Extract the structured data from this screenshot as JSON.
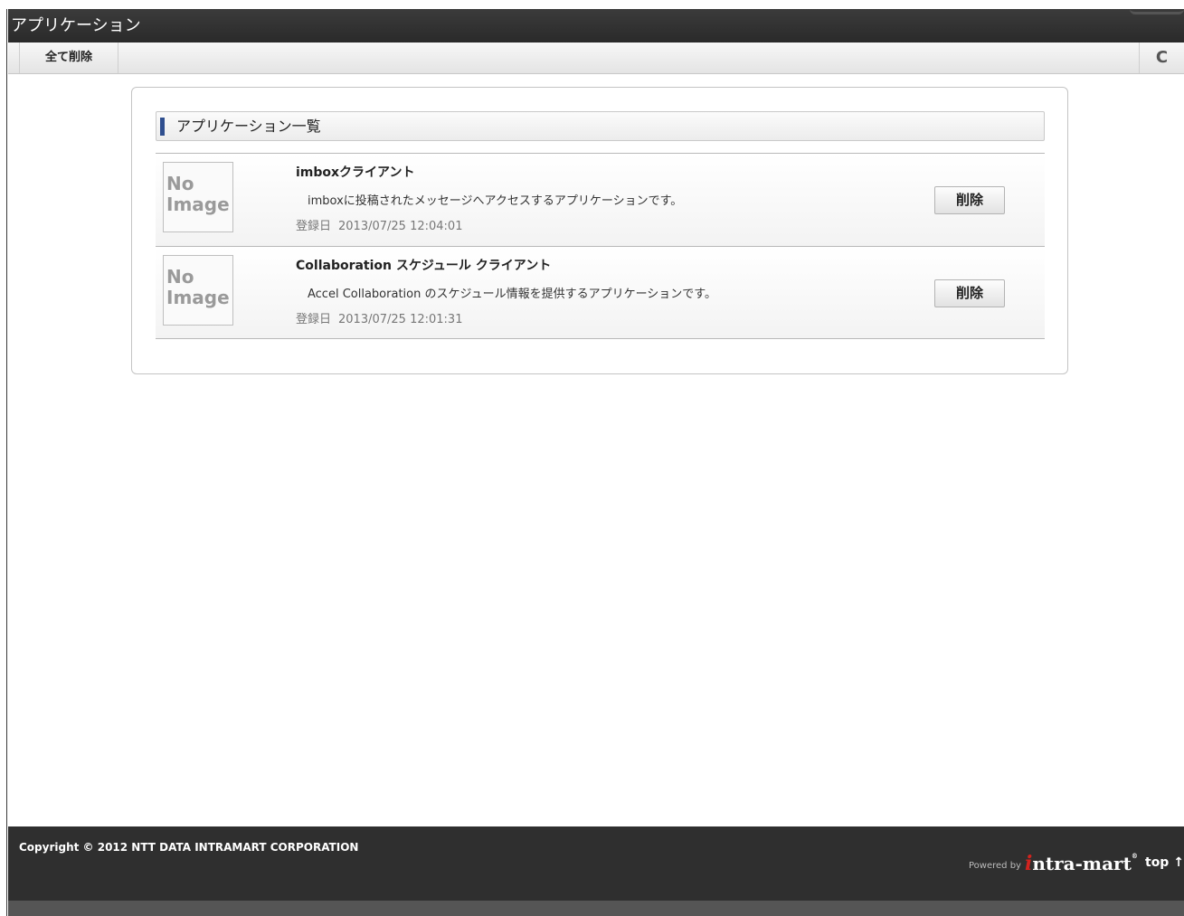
{
  "window": {
    "title": "アプリケーション"
  },
  "toolbar": {
    "delete_all_label": "全て削除",
    "refresh_icon": "C"
  },
  "section": {
    "heading": "アプリケーション一覧"
  },
  "applications": [
    {
      "thumbnail_line1": "No",
      "thumbnail_line2": "Image",
      "name": "imboxクライアント",
      "description": "imboxに投稿されたメッセージへアクセスするアプリケーションです。",
      "registered_label": "登録日",
      "registered_at": "2013/07/25 12:04:01",
      "delete_label": "削除"
    },
    {
      "thumbnail_line1": "No",
      "thumbnail_line2": "Image",
      "name": "Collaboration スケジュール クライアント",
      "description": "Accel Collaboration のスケジュール情報を提供するアプリケーションです。",
      "registered_label": "登録日",
      "registered_at": "2013/07/25 12:01:31",
      "delete_label": "削除"
    }
  ],
  "footer": {
    "copyright": "Copyright © 2012 NTT DATA INTRAMART CORPORATION",
    "powered_by": "Powered by",
    "logo_initial": "i",
    "logo_rest": "ntra-mart",
    "logo_reg": "®",
    "top_link": "top ↑"
  },
  "colors": {
    "titlebar": "#2f2f2f",
    "footer": "#2f2f2f",
    "section_accent": "#2f4f8f",
    "logo_red": "#d2231e"
  }
}
